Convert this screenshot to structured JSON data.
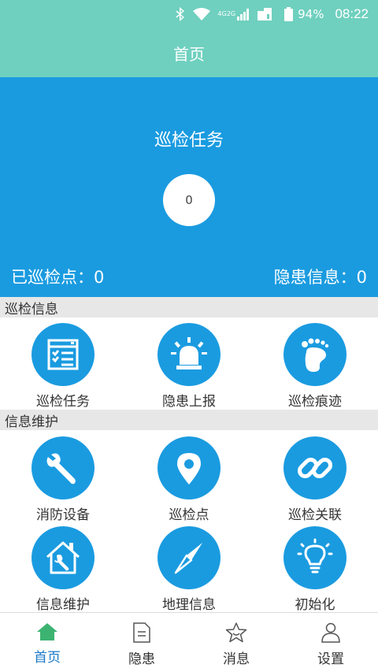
{
  "status_bar": {
    "battery": "94%",
    "time": "08:22",
    "network_top": "4G",
    "network_bottom": "2G",
    "icons": [
      "bluetooth-icon",
      "wifi-icon",
      "signal-icon",
      "sim-icon",
      "battery-icon"
    ]
  },
  "header": {
    "title": "首页"
  },
  "hero": {
    "title": "巡检任务",
    "count": "0",
    "left_stat": "已巡检点：0",
    "right_stat": "隐患信息：0"
  },
  "sections": {
    "inspection": {
      "title": "巡检信息",
      "items": [
        {
          "label": "巡检任务",
          "icon": "task-list-icon"
        },
        {
          "label": "隐患上报",
          "icon": "alarm-light-icon"
        },
        {
          "label": "巡检痕迹",
          "icon": "footprint-icon"
        }
      ]
    },
    "maintenance": {
      "title": "信息维护",
      "items": [
        {
          "label": "消防设备",
          "icon": "wrench-icon"
        },
        {
          "label": "巡检点",
          "icon": "location-pin-icon"
        },
        {
          "label": "巡检关联",
          "icon": "link-icon"
        },
        {
          "label": "信息维护",
          "icon": "house-wrench-icon"
        },
        {
          "label": "地理信息",
          "icon": "compass-icon"
        },
        {
          "label": "初始化",
          "icon": "lightbulb-icon"
        }
      ]
    }
  },
  "bottom_nav": {
    "items": [
      {
        "label": "首页",
        "icon": "home-icon",
        "active": true
      },
      {
        "label": "隐患",
        "icon": "document-icon",
        "active": false
      },
      {
        "label": "消息",
        "icon": "star-icon",
        "active": false
      },
      {
        "label": "设置",
        "icon": "person-icon",
        "active": false
      }
    ]
  },
  "colors": {
    "accent_teal": "#6fd0bf",
    "primary_blue": "#1a9be0",
    "active_nav_blue": "#1a78c8",
    "active_home_green": "#3cb371",
    "section_bg": "#e7e7e7"
  }
}
